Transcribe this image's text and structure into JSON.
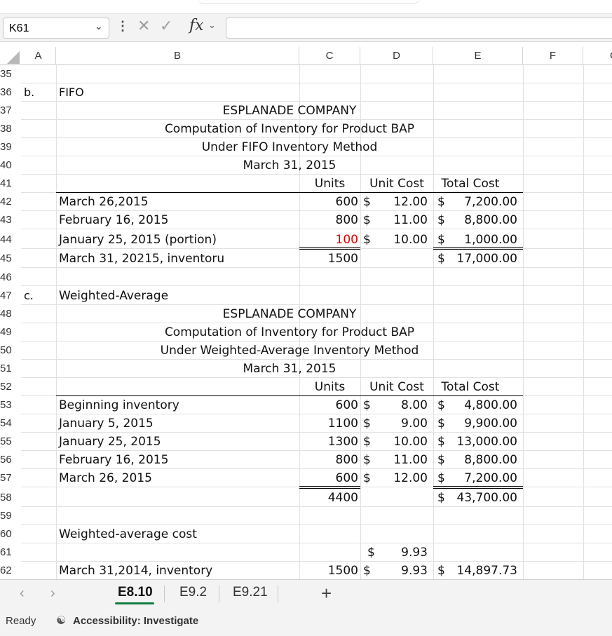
{
  "formula_bar": {
    "name_box": "K61",
    "fx_label": "fx",
    "formula": ""
  },
  "columns": [
    "A",
    "B",
    "C",
    "D",
    "E",
    "F",
    "G"
  ],
  "rows": [
    "35",
    "36",
    "37",
    "38",
    "39",
    "40",
    "41",
    "42",
    "43",
    "44",
    "45",
    "46",
    "47",
    "48",
    "49",
    "50",
    "51",
    "52",
    "53",
    "54",
    "55",
    "56",
    "57",
    "58",
    "59",
    "60",
    "61",
    "62"
  ],
  "cells": {
    "a36": "b.",
    "b36": "FIFO",
    "t37": "ESPLANADE COMPANY",
    "t38": "Computation of Inventory for Product BAP",
    "t39": "Under FIFO Inventory Method",
    "t40": "March 31, 2015",
    "h41_units": "Units",
    "h41_unit_cost": "Unit Cost",
    "h41_total_cost": "Total Cost",
    "b42": "March 26,2015",
    "c42": "600",
    "d42": "$",
    "d42v": "12.00",
    "e42": "$",
    "e42v": "7,200.00",
    "b43": "February 16, 2015",
    "c43": "800",
    "d43": "$",
    "d43v": "11.00",
    "e43": "$",
    "e43v": "8,800.00",
    "b44": "January 25, 2015 (portion)",
    "c44": "100",
    "d44": "$",
    "d44v": "10.00",
    "e44": "$",
    "e44v": "1,000.00",
    "b45": "March 31, 20215, inventoru",
    "c45": "1500",
    "e45": "$",
    "e45v": "17,000.00",
    "a47": "c.",
    "b47": "Weighted-Average",
    "t48": "ESPLANADE COMPANY",
    "t49": "Computation of Inventory for Product BAP",
    "t50": "Under Weighted-Average Inventory Method",
    "t51": "March 31, 2015",
    "h52_units": "Units",
    "h52_unit_cost": "Unit Cost",
    "h52_total_cost": "Total Cost",
    "b53": "Beginning inventory",
    "c53": "600",
    "d53": "$",
    "d53v": "8.00",
    "e53": "$",
    "e53v": "4,800.00",
    "b54": "January 5, 2015",
    "c54": "1100",
    "d54": "$",
    "d54v": "9.00",
    "e54": "$",
    "e54v": "9,900.00",
    "b55": "January 25, 2015",
    "c55": "1300",
    "d55": "$",
    "d55v": "10.00",
    "e55": "$",
    "e55v": "13,000.00",
    "b56": "February 16, 2015",
    "c56": "800",
    "d56": "$",
    "d56v": "11.00",
    "e56": "$",
    "e56v": "8,800.00",
    "b57": "March 26, 2015",
    "c57": "600",
    "d57": "$",
    "d57v": "12.00",
    "e57": "$",
    "e57v": "7,200.00",
    "c58": "4400",
    "e58": "$",
    "e58v": "43,700.00",
    "b60": "Weighted-average cost",
    "d61": "$",
    "d61v": "9.93",
    "b62": "March 31,2014, inventory",
    "c62": "1500",
    "d62": "$",
    "d62v": "9.93",
    "e62": "$",
    "e62v": "14,897.73"
  },
  "tabs": {
    "items": [
      "E8.10",
      "E9.2",
      "E9.21"
    ],
    "active": "E8.10",
    "add": "+"
  },
  "status": {
    "ready": "Ready",
    "accessibility": "Accessibility: Investigate"
  },
  "colors": {
    "accent": "#107c41",
    "highlight_red": "#e00000"
  }
}
